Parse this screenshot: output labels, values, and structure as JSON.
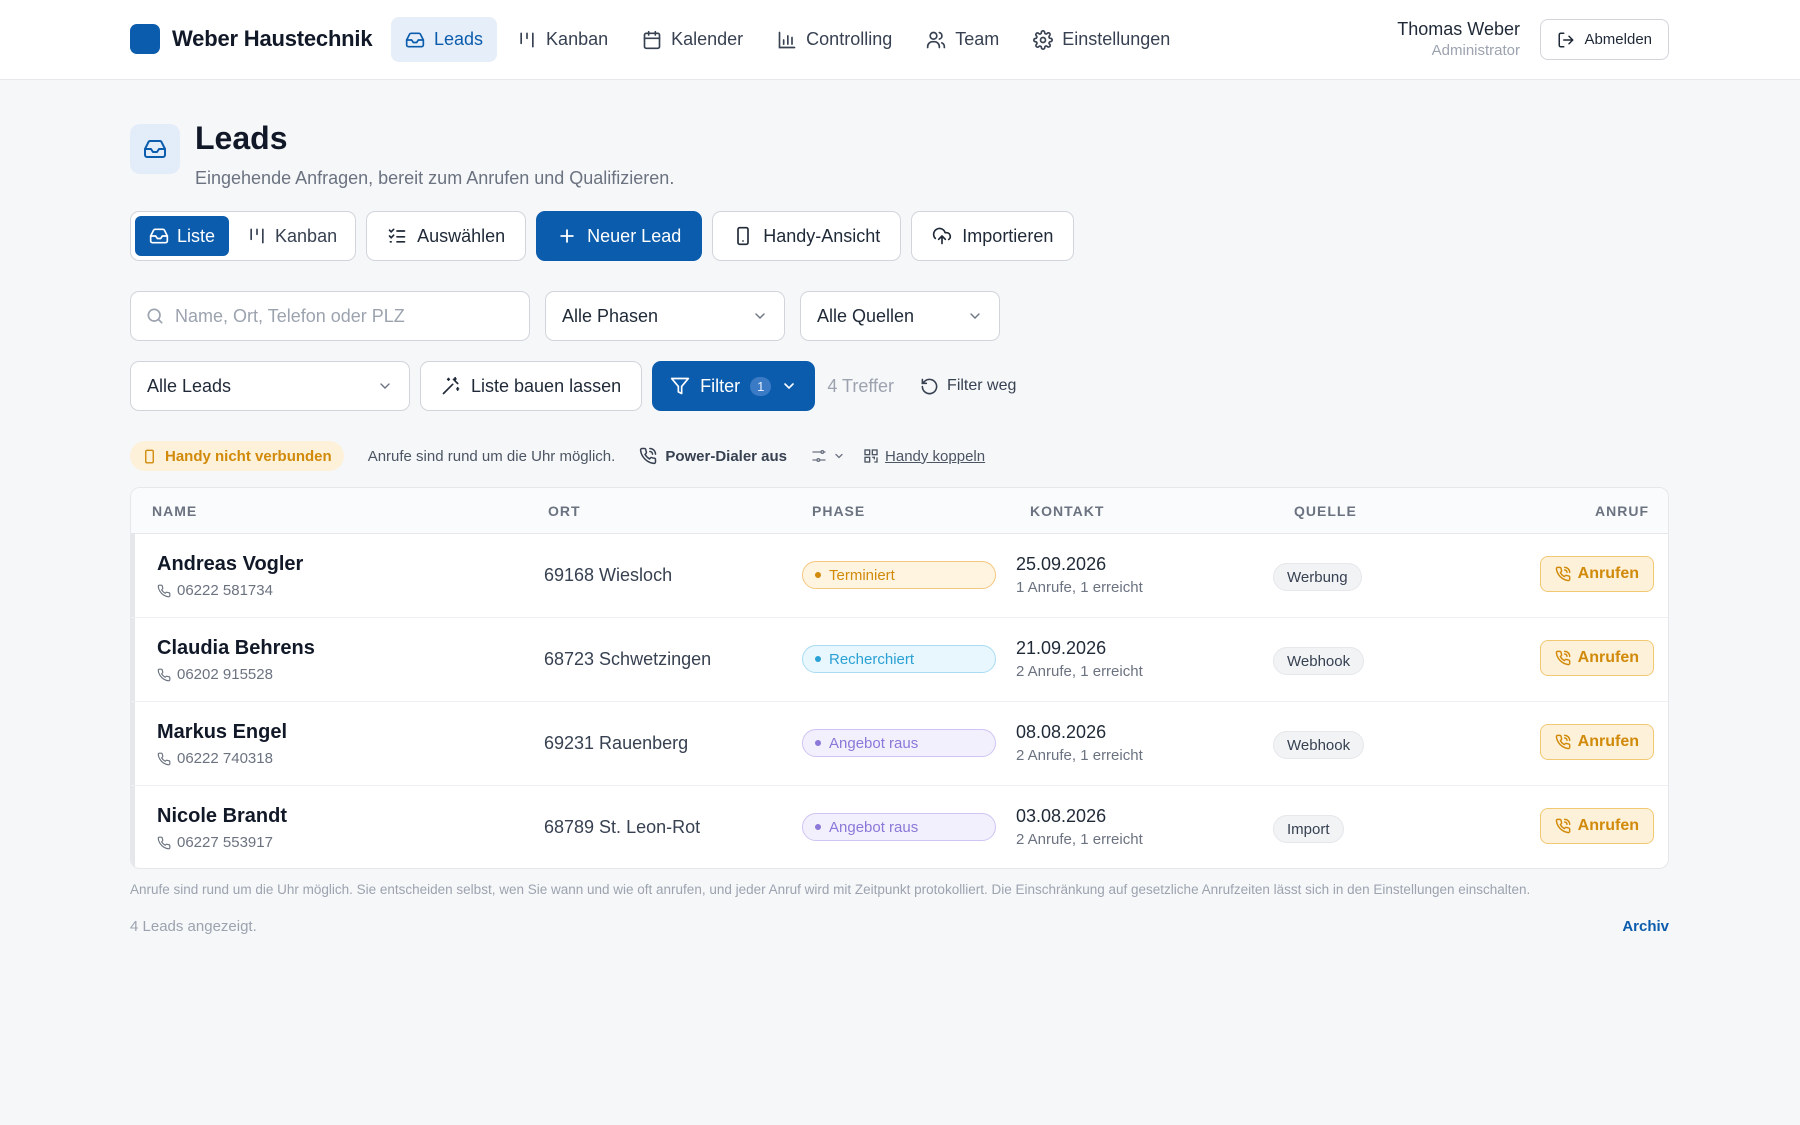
{
  "header": {
    "brand": "Weber Haustechnik",
    "nav": [
      {
        "label": "Leads",
        "icon": "inbox-icon",
        "active": true
      },
      {
        "label": "Kanban",
        "icon": "kanban-icon"
      },
      {
        "label": "Kalender",
        "icon": "calendar-icon"
      },
      {
        "label": "Controlling",
        "icon": "bar-chart-icon"
      },
      {
        "label": "Team",
        "icon": "users-icon"
      },
      {
        "label": "Einstellungen",
        "icon": "gear-icon"
      }
    ],
    "user_name": "Thomas Weber",
    "user_role": "Administrator",
    "logout_label": "Abmelden"
  },
  "page": {
    "title": "Leads",
    "subtitle": "Eingehende Anfragen, bereit zum Anrufen und Qualifizieren."
  },
  "toolbar": {
    "view_list": "Liste",
    "view_kanban": "Kanban",
    "select": "Auswählen",
    "new_lead": "Neuer Lead",
    "mobile_view": "Handy-Ansicht",
    "import": "Importieren"
  },
  "filters": {
    "search_placeholder": "Name, Ort, Telefon oder PLZ",
    "search_value": "",
    "phase": "Alle Phasen",
    "source": "Alle Quellen",
    "scope": "Alle Leads",
    "build_list": "Liste bauen lassen",
    "filter_label": "Filter",
    "filter_count": "1",
    "hits": "4 Treffer",
    "reset": "Filter weg"
  },
  "status": {
    "phone_badge": "Handy nicht verbunden",
    "info": "Anrufe sind rund um die Uhr möglich.",
    "dialer": "Power-Dialer aus",
    "pair": "Handy koppeln"
  },
  "table": {
    "headers": {
      "name": "NAME",
      "ort": "ORT",
      "phase": "PHASE",
      "kontakt": "KONTAKT",
      "quelle": "QUELLE",
      "anruf": "ANRUF"
    },
    "call_label": "Anrufen",
    "rows": [
      {
        "name": "Andreas Vogler",
        "phone": "06222 581734",
        "ort": "69168 Wiesloch",
        "phase": "Terminiert",
        "phase_kind": "warn",
        "date": "25.09.2026",
        "calls": "1 Anrufe, 1 erreicht",
        "source": "Werbung"
      },
      {
        "name": "Claudia Behrens",
        "phone": "06202 915528",
        "ort": "68723 Schwetzingen",
        "phase": "Recherchiert",
        "phase_kind": "info",
        "date": "21.09.2026",
        "calls": "2 Anrufe, 1 erreicht",
        "source": "Webhook"
      },
      {
        "name": "Markus Engel",
        "phone": "06222 740318",
        "ort": "69231 Rauenberg",
        "phase": "Angebot raus",
        "phase_kind": "purple",
        "date": "08.08.2026",
        "calls": "2 Anrufe, 1 erreicht",
        "source": "Webhook"
      },
      {
        "name": "Nicole Brandt",
        "phone": "06227 553917",
        "ort": "68789 St. Leon-Rot",
        "phase": "Angebot raus",
        "phase_kind": "purple",
        "date": "03.08.2026",
        "calls": "2 Anrufe, 1 erreicht",
        "source": "Import"
      }
    ]
  },
  "footer": {
    "note": "Anrufe sind rund um die Uhr möglich. Sie entscheiden selbst, wen Sie wann und wie oft anrufen, und jeder Anruf wird mit Zeitpunkt protokolliert. Die Einschränkung auf gesetzliche Anrufzeiten lässt sich in den Einstellungen einschalten.",
    "count": "4 Leads angezeigt.",
    "archive": "Archiv"
  },
  "colors": {
    "accent": "#0b5cad",
    "warn": "#d18a0a",
    "phase_warn_bg": "#fff4e0",
    "phase_warn_border": "#f5c77e",
    "phase_info_bg": "#e8f6fd",
    "phase_info_border": "#a9dcf3",
    "phase_info_fg": "#2aa1d4",
    "phase_purple_bg": "#f3f0fd",
    "phase_purple_border": "#cfc4f3",
    "phase_purple_fg": "#8b78d8"
  }
}
